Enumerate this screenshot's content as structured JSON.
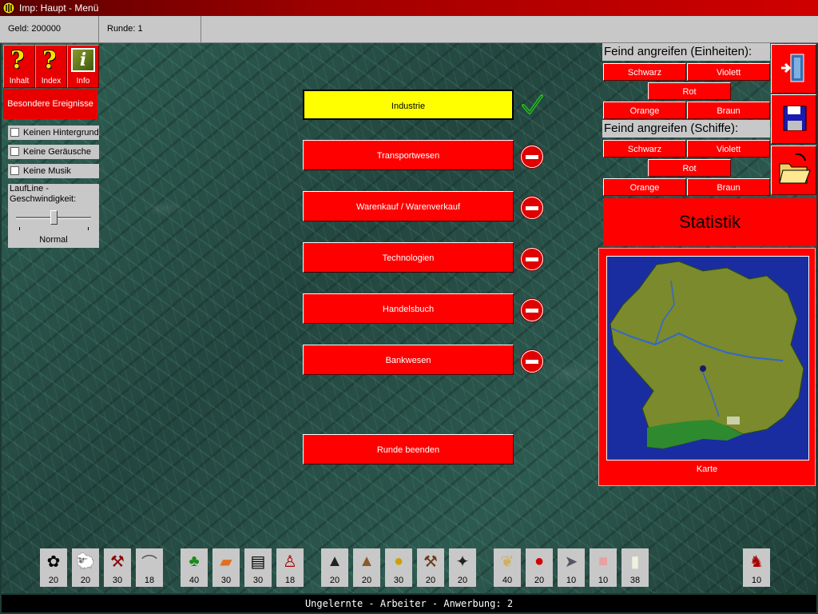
{
  "window": {
    "title": "Imp: Haupt - Menü"
  },
  "infobar": {
    "money": "Geld:  200000",
    "round": "Runde: 1"
  },
  "help": {
    "contents": "Inhalt",
    "index": "Index",
    "info": "Info"
  },
  "special_events": "Besondere Ereignisse",
  "options": {
    "no_background": "Keinen Hintergrund",
    "no_sounds": "Keine Geräusche",
    "no_music": "Keine Musik"
  },
  "ticker_speed": {
    "label": "LaufLine - Geschwindigkeit:",
    "value": "Normal"
  },
  "menu": [
    {
      "label": "Industrie",
      "state": "done"
    },
    {
      "label": "Transportwesen",
      "state": "blocked"
    },
    {
      "label": "Warenkauf / Warenverkauf",
      "state": "blocked"
    },
    {
      "label": "Technologien",
      "state": "blocked"
    },
    {
      "label": "Handelsbuch",
      "state": "blocked"
    },
    {
      "label": "Bankwesen",
      "state": "blocked"
    }
  ],
  "end_round": "Runde beenden",
  "attack": {
    "units_title": "Feind angreifen (Einheiten):",
    "ships_title": "Feind angreifen (Schiffe):",
    "colors": {
      "black": "Schwarz",
      "violet": "Violett",
      "red": "Rot",
      "orange": "Orange",
      "brown": "Braun"
    }
  },
  "statistics": "Statistik",
  "map": {
    "label": "Karte"
  },
  "resources": [
    {
      "icon": "cotton-icon",
      "value": "20"
    },
    {
      "icon": "sheep-icon",
      "value": "20"
    },
    {
      "icon": "tools-icon",
      "value": "30"
    },
    {
      "icon": "horseshoe-icon",
      "value": "18"
    },
    {
      "icon": "tree-icon",
      "value": "40"
    },
    {
      "icon": "plank-icon",
      "value": "30"
    },
    {
      "icon": "book-icon",
      "value": "30"
    },
    {
      "icon": "chair-icon",
      "value": "18"
    },
    {
      "icon": "coal-icon",
      "value": "20"
    },
    {
      "icon": "ore-icon",
      "value": "20"
    },
    {
      "icon": "gold-pot-icon",
      "value": "30"
    },
    {
      "icon": "hammer-icon",
      "value": "20"
    },
    {
      "icon": "cannon-icon",
      "value": "20"
    },
    {
      "icon": "wheat-icon",
      "value": "40"
    },
    {
      "icon": "fruit-icon",
      "value": "20"
    },
    {
      "icon": "fish-icon",
      "value": "10"
    },
    {
      "icon": "pig-icon",
      "value": "10"
    },
    {
      "icon": "milk-icon",
      "value": "38"
    },
    {
      "icon": "horse-icon",
      "value": "10"
    }
  ],
  "statusbar": "Ungelernte - Arbeiter - Anwerbung: 2"
}
